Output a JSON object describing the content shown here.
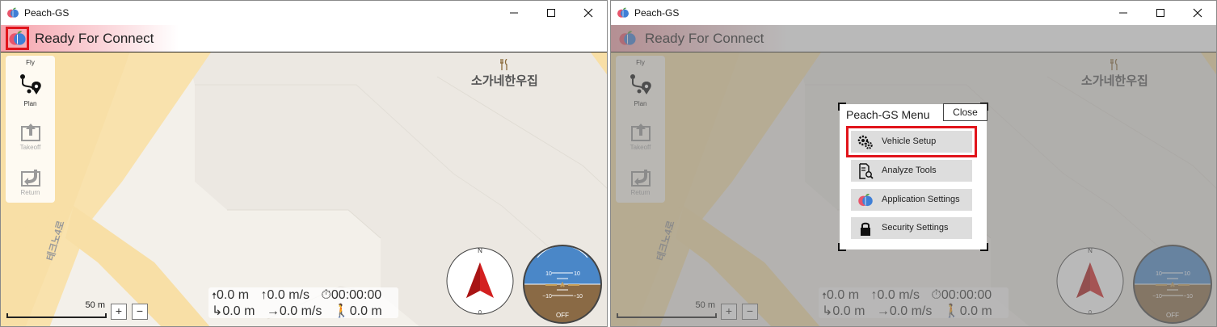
{
  "app": {
    "title": "Peach-GS",
    "status_text": "Ready For Connect"
  },
  "map": {
    "poi_label": "소가네한우집",
    "road_label": "테크노4로",
    "scale_label": "50 m",
    "zoom_in_label": "+",
    "zoom_out_label": "−"
  },
  "toolstrip": {
    "header": "Fly",
    "plan_label": "Plan",
    "takeoff_label": "Takeoff",
    "return_label": "Return"
  },
  "telemetry": {
    "altitude": "0.0 m",
    "vertical_speed": "0.0 m/s",
    "flight_time": "00:00:00",
    "distance": "0.0 m",
    "ground_speed": "0.0 m/s",
    "home_distance": "0.0 m"
  },
  "compass": {
    "north_label": "N",
    "heading_label": "0"
  },
  "attitude": {
    "pitch_up_left": "10",
    "pitch_up_right": "10",
    "pitch_down_left": "−10",
    "pitch_down_right": "−10",
    "status": "OFF"
  },
  "menu": {
    "title": "Peach-GS Menu",
    "close_label": "Close",
    "items": [
      {
        "label": "Vehicle Setup",
        "icon": "gears-icon"
      },
      {
        "label": "Analyze Tools",
        "icon": "document-search-icon"
      },
      {
        "label": "Application Settings",
        "icon": "peach-logo-icon"
      },
      {
        "label": "Security Settings",
        "icon": "lock-icon"
      }
    ]
  },
  "colors": {
    "highlight": "#e1141b",
    "status_gradient": "#f5a3ac",
    "compass_arrow": "#d32020",
    "sky": "#4a87c8",
    "ground": "#8a6a45"
  }
}
